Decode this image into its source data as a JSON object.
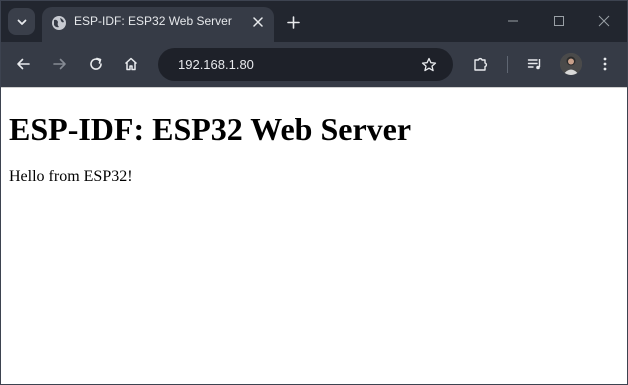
{
  "tab": {
    "title": "ESP-IDF: ESP32 Web Server",
    "favicon": "globe-icon"
  },
  "toolbar": {
    "url": "192.168.1.80"
  },
  "page": {
    "heading": "ESP-IDF: ESP32 Web Server",
    "paragraph": "Hello from ESP32!"
  },
  "colors": {
    "frame": "#22262f",
    "toolbar": "#363b46",
    "omnibox": "#1e2129",
    "text_light": "#e8eaed"
  }
}
